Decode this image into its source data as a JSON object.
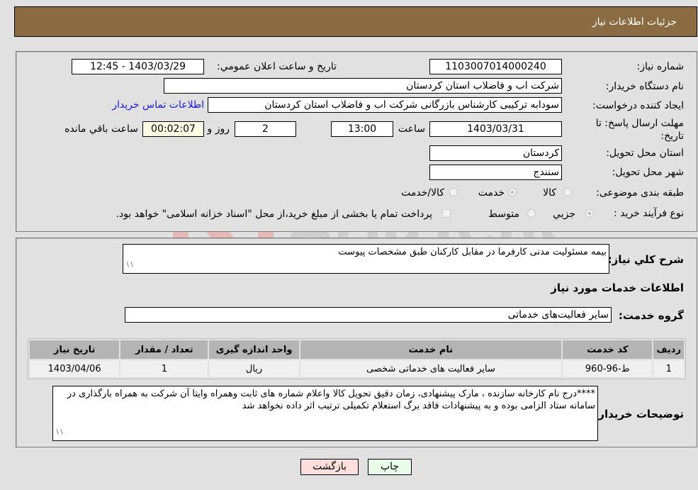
{
  "header": {
    "title": "جزئیات اطلاعات نیاز"
  },
  "form": {
    "need_number_label": "شماره نیاز:",
    "need_number": "1103007014000240",
    "announce_label": "تاریخ و ساعت اعلان عمومي:",
    "announce_value": "1403/03/29 - 12:45",
    "buyer_org_label": "نام دستگاه خریدار:",
    "buyer_org": "شرکت اب و فاضلاب استان کردستان",
    "creator_label": "ایجاد کننده درخواست:",
    "creator": "سودابه ترکیبی کارشناس بازرگانی شرکت اب و فاضلاب استان کردستان",
    "contact_link": "اطلاعات تماس خریدار",
    "deadline_label_line1": "مهلت ارسال پاسخ: تا",
    "deadline_label_line2": "تاریخ:",
    "deadline_date": "1403/03/31",
    "time_label": "ساعت",
    "deadline_time": "13:00",
    "days_value": "2",
    "days_label": "روز و",
    "remaining_time": "00:02:07",
    "remaining_label": "ساعت باقي مانده",
    "province_label": "استان محل تحویل:",
    "province": "کردستان",
    "city_label": "شهر محل تحویل:",
    "city": "سنندج",
    "category_label": "طبقه بندی موضوعی:",
    "category_options": [
      "کالا",
      "خدمت",
      "کالا/خدمت"
    ],
    "category_selected": "خدمت",
    "process_label": "نوع فرآیند خرید :",
    "process_options": [
      "جزیي",
      "متوسط"
    ],
    "process_selected": "جزیي",
    "treasury_note": "پرداخت تمام یا بخشی از مبلغ خرید،از محل \"اسناد خزانه اسلامی\" خواهد بود."
  },
  "details": {
    "description_label": "شرح کلي نیاز:",
    "description": "بیمه مسئولیت مدنی کارفرما در مقابل کارکنان طبق مشخصات پیوست",
    "services_heading": "اطلاعات خدمات مورد نیاز",
    "service_group_label": "گروه خدمت:",
    "service_group": "سایر فعالیت‌های خدماتی",
    "table": {
      "headers": [
        "ردیف",
        "کد خدمت",
        "نام خدمت",
        "واحد اندازه گیری",
        "تعداد / مقدار",
        "تاریخ نیاز"
      ],
      "rows": [
        [
          "1",
          "ط-96-960",
          "سایر فعالیت های خدماتی شخصی",
          "ریال",
          "1",
          "1403/04/06"
        ]
      ]
    },
    "buyer_notes_label": "توضیحات خریدار:",
    "buyer_notes": "****درج نام کارخانه سازنده ، مارک پیشنهادی، زمان دقیق تحویل کالا واعلام شماره های ثابت وهمراه وایتا آن شرکت به همراه بارگذاری در سامانه ستاد الزامی بوده و به پیشنهادات فاقد برگ استعلام تکمیلی ترتیب اثر داده نخواهد شد"
  },
  "buttons": {
    "print": "چاپ",
    "back": "بازگشت"
  },
  "colors": {
    "header_bg": "#8b6c42",
    "print_bg": "#eaffea",
    "back_bg": "#ffdede",
    "remaining_bg": "#ffffe6",
    "link": "#1a1ad6"
  }
}
